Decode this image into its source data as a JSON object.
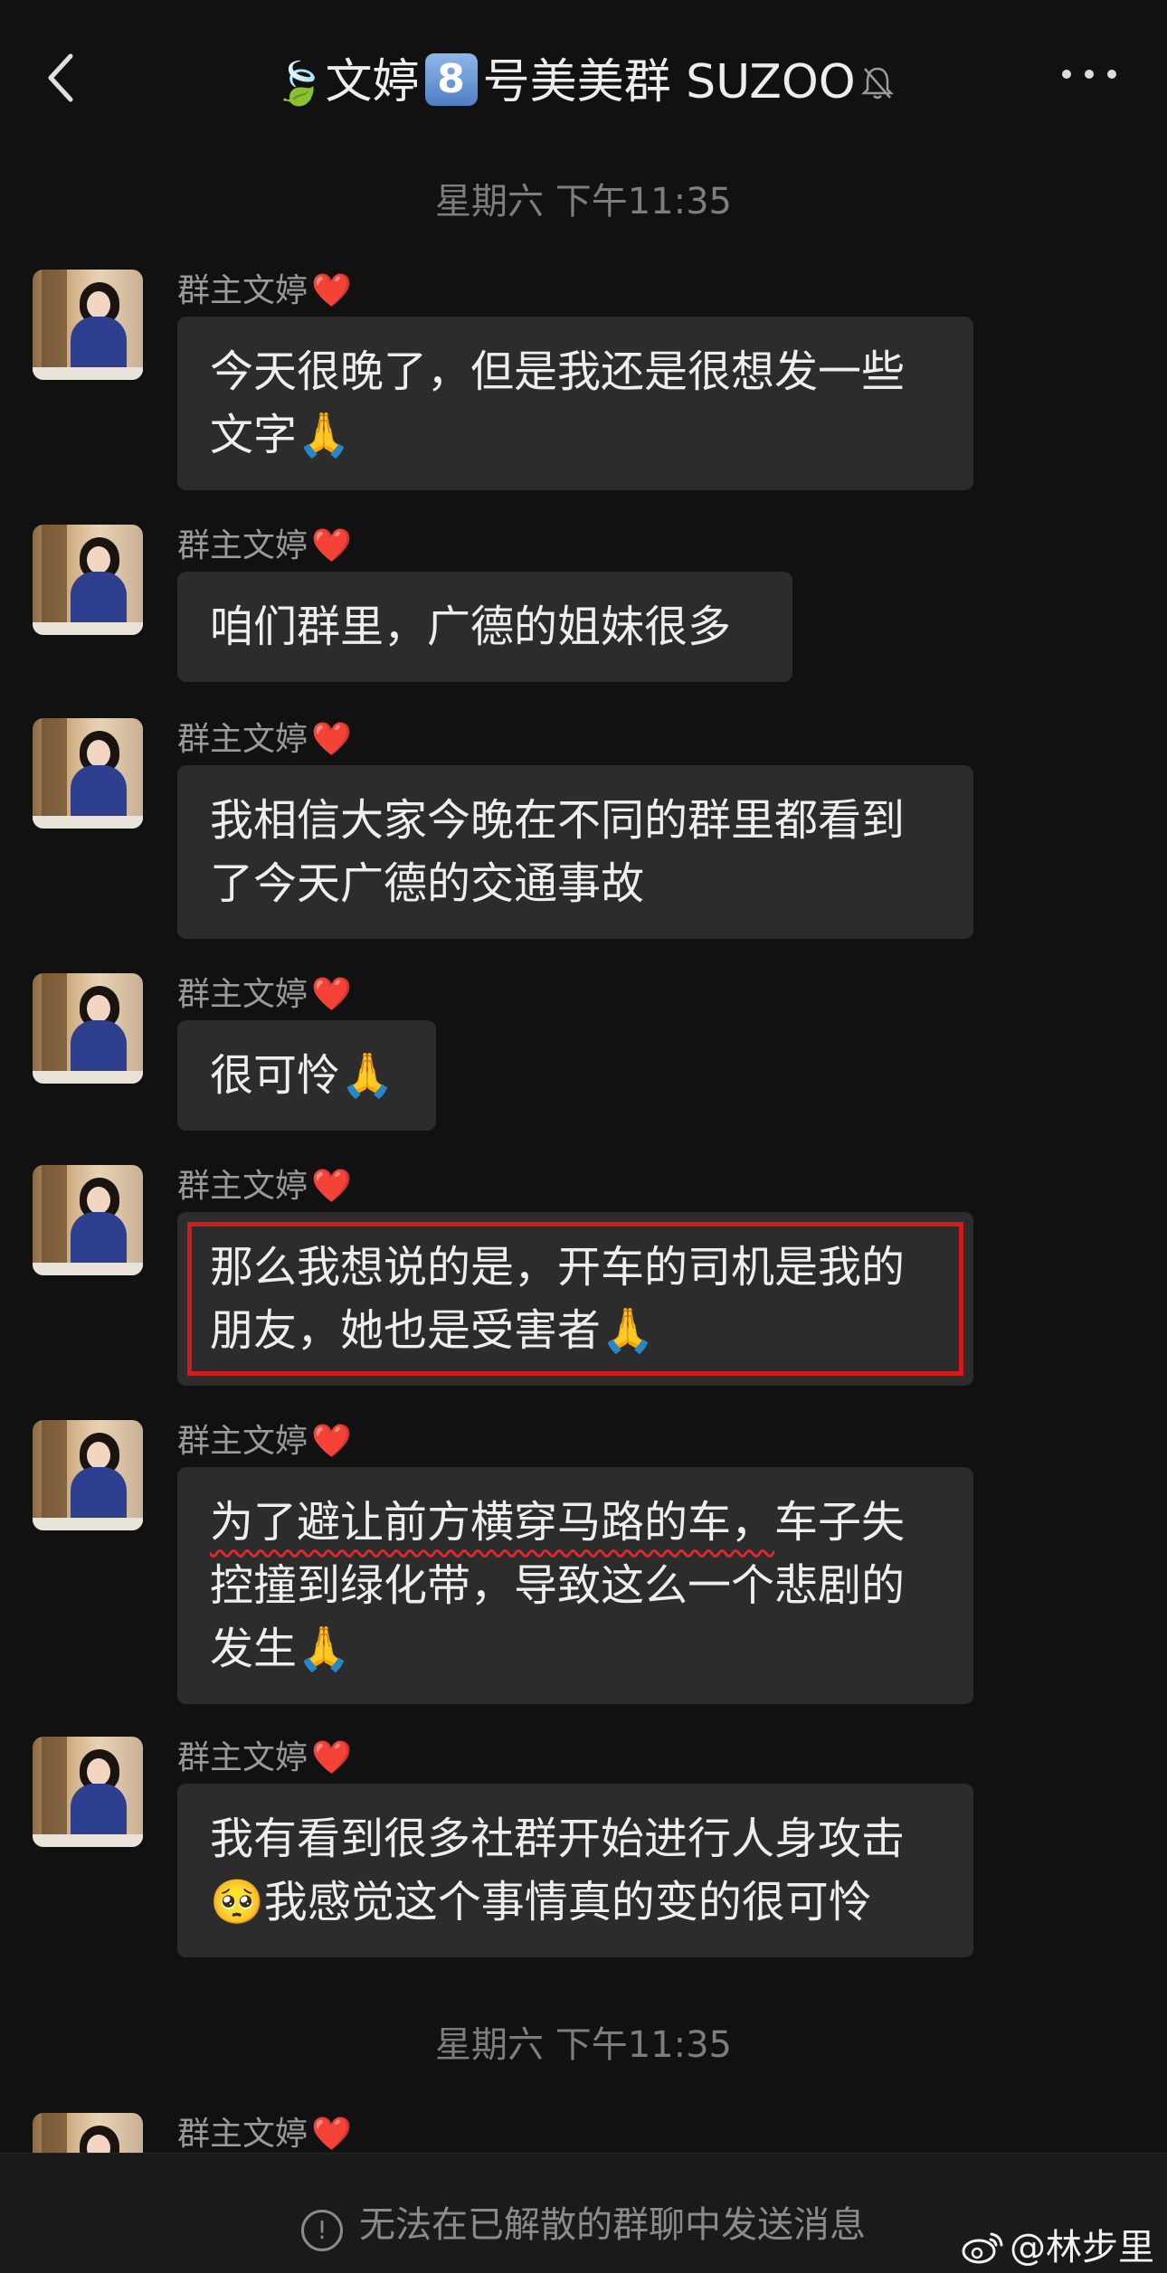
{
  "header": {
    "leaf_emoji": "🍃",
    "title_part1": "文婷",
    "title_number": "8",
    "title_part2": "号美美群 SUZOO",
    "icons": [
      "back-arrow-icon",
      "mute-bell-icon",
      "more-icon"
    ]
  },
  "timestamps": [
    "星期六 下午11:35",
    "星期六 下午11:35"
  ],
  "messages": [
    {
      "sender": "群主文婷",
      "heart": "❤️",
      "lines": [
        "今天很晚了，但是我还是很想发一些",
        "文字🙏"
      ]
    },
    {
      "sender": "群主文婷",
      "heart": "❤️",
      "lines": [
        "咱们群里，广德的姐妹很多"
      ]
    },
    {
      "sender": "群主文婷",
      "heart": "❤️",
      "lines": [
        "我相信大家今晚在不同的群里都看到",
        "了今天广德的交通事故"
      ]
    },
    {
      "sender": "群主文婷",
      "heart": "❤️",
      "lines": [
        "很可怜🙏"
      ]
    },
    {
      "sender": "群主文婷",
      "heart": "❤️",
      "lines": [
        "那么我想说的是，开车的司机是我的",
        "朋友，她也是受害者🙏"
      ],
      "highlighted": true
    },
    {
      "sender": "群主文婷",
      "heart": "❤️",
      "underlined": "为了避让前方横穿马路的车，",
      "line1_rest": "车子失",
      "lines": [
        "控撞到绿化带，导致这么一个悲剧的",
        "发生🙏"
      ]
    },
    {
      "sender": "群主文婷",
      "heart": "❤️",
      "lines": [
        "我有看到很多社群开始进行人身攻击",
        "🥺我感觉这个事情真的变的很可怜"
      ]
    },
    {
      "sender": "群主文婷",
      "heart": "❤️",
      "lines": []
    }
  ],
  "footer": {
    "notice": "无法在已解散的群聊中发送消息",
    "watermark": "@林步里"
  },
  "colors": {
    "background": "#111111",
    "bubble": "#2c2c2c",
    "highlight_box": "#d31a1d",
    "heart": "#e8323c"
  }
}
